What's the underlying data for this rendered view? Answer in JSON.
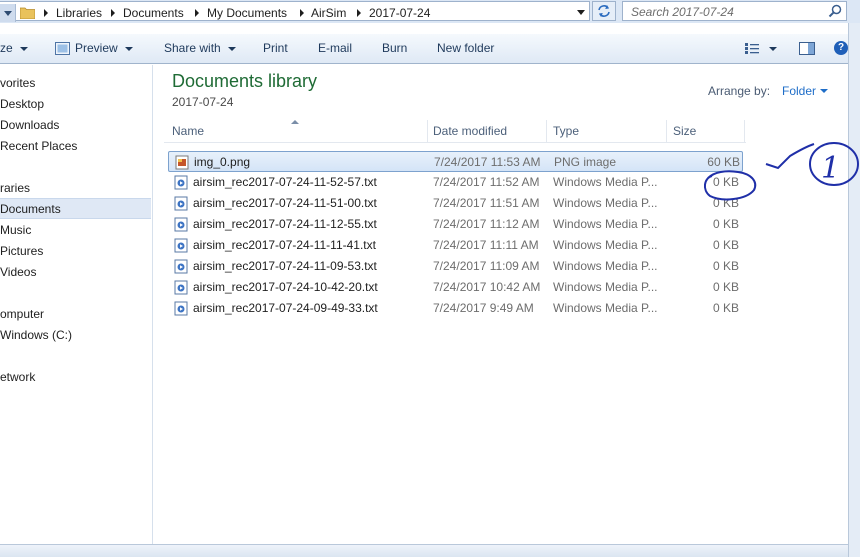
{
  "address_bar": {
    "breadcrumbs": [
      "Libraries",
      "Documents",
      "My Documents",
      "AirSim",
      "2017-07-24"
    ],
    "search_placeholder": "Search 2017-07-24"
  },
  "toolbar": {
    "organize_label": "ze",
    "preview_label": "Preview",
    "share_label": "Share with",
    "print_label": "Print",
    "email_label": "E-mail",
    "burn_label": "Burn",
    "newfolder_label": "New folder"
  },
  "nav": {
    "items": [
      {
        "label": "vorites"
      },
      {
        "label": "Desktop"
      },
      {
        "label": "Downloads"
      },
      {
        "label": "Recent Places"
      },
      {
        "label": "raries"
      },
      {
        "label": "Documents",
        "selected": true
      },
      {
        "label": "Music"
      },
      {
        "label": "Pictures"
      },
      {
        "label": "Videos"
      },
      {
        "label": "omputer"
      },
      {
        "label": "Windows (C:)"
      },
      {
        "label": "etwork"
      }
    ]
  },
  "library": {
    "title": "Documents library",
    "subtitle": "2017-07-24",
    "arrange_label": "Arrange by:",
    "arrange_value": "Folder"
  },
  "columns": {
    "name": "Name",
    "date": "Date modified",
    "type": "Type",
    "size": "Size"
  },
  "files": [
    {
      "name": "img_0.png",
      "date": "7/24/2017 11:53 AM",
      "type": "PNG image",
      "size": "60 KB",
      "icon": "png-file-icon",
      "selected": true
    },
    {
      "name": "airsim_rec2017-07-24-11-52-57.txt",
      "date": "7/24/2017 11:52 AM",
      "type": "Windows Media P...",
      "size": "0 KB",
      "icon": "txt-file-icon"
    },
    {
      "name": "airsim_rec2017-07-24-11-51-00.txt",
      "date": "7/24/2017 11:51 AM",
      "type": "Windows Media P...",
      "size": "0 KB",
      "icon": "txt-file-icon"
    },
    {
      "name": "airsim_rec2017-07-24-11-12-55.txt",
      "date": "7/24/2017 11:12 AM",
      "type": "Windows Media P...",
      "size": "0 KB",
      "icon": "txt-file-icon"
    },
    {
      "name": "airsim_rec2017-07-24-11-11-41.txt",
      "date": "7/24/2017 11:11 AM",
      "type": "Windows Media P...",
      "size": "0 KB",
      "icon": "txt-file-icon"
    },
    {
      "name": "airsim_rec2017-07-24-11-09-53.txt",
      "date": "7/24/2017 11:09 AM",
      "type": "Windows Media P...",
      "size": "0 KB",
      "icon": "txt-file-icon"
    },
    {
      "name": "airsim_rec2017-07-24-10-42-20.txt",
      "date": "7/24/2017 10:42 AM",
      "type": "Windows Media P...",
      "size": "0 KB",
      "icon": "txt-file-icon"
    },
    {
      "name": "airsim_rec2017-07-24-09-49-33.txt",
      "date": "7/24/2017 9:49 AM",
      "type": "Windows Media P...",
      "size": "0 KB",
      "icon": "txt-file-icon"
    }
  ],
  "annotation": {
    "label": "1",
    "color": "#1f2fa8"
  },
  "colors": {
    "selection": "#d4e4f7",
    "title_green": "#1f6b35",
    "link_blue": "#1e6dc8"
  }
}
